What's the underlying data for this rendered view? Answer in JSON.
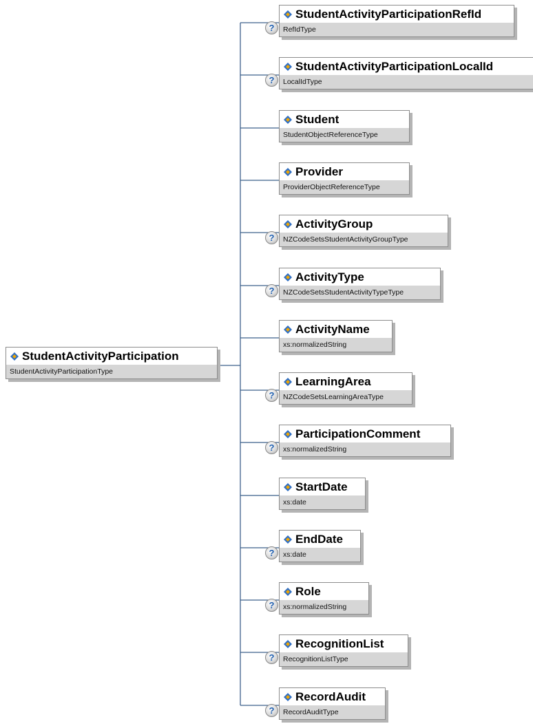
{
  "root": {
    "name": "StudentActivityParticipation",
    "type": "StudentActivityParticipationType"
  },
  "optional_marker": "?",
  "icon": "element-diamond-icon",
  "colors": {
    "connector": "#3b5f8a",
    "type_band": "#d6d6d6",
    "icon_blue": "#2f6fc4",
    "icon_orange": "#f2a600"
  },
  "children": [
    {
      "name": "StudentActivityParticipationRefId",
      "type": "RefIdType",
      "optional": true
    },
    {
      "name": "StudentActivityParticipationLocalId",
      "type": "LocalIdType",
      "optional": true
    },
    {
      "name": "Student",
      "type": "StudentObjectReferenceType",
      "optional": false
    },
    {
      "name": "Provider",
      "type": "ProviderObjectReferenceType",
      "optional": false
    },
    {
      "name": "ActivityGroup",
      "type": "NZCodeSetsStudentActivityGroupType",
      "optional": true
    },
    {
      "name": "ActivityType",
      "type": "NZCodeSetsStudentActivityTypeType",
      "optional": true
    },
    {
      "name": "ActivityName",
      "type": "xs:normalizedString",
      "optional": false
    },
    {
      "name": "LearningArea",
      "type": "NZCodeSetsLearningAreaType",
      "optional": true
    },
    {
      "name": "ParticipationComment",
      "type": "xs:normalizedString",
      "optional": true
    },
    {
      "name": "StartDate",
      "type": "xs:date",
      "optional": false
    },
    {
      "name": "EndDate",
      "type": "xs:date",
      "optional": true
    },
    {
      "name": "Role",
      "type": "xs:normalizedString",
      "optional": true
    },
    {
      "name": "RecognitionList",
      "type": "RecognitionListType",
      "optional": true
    },
    {
      "name": "RecordAudit",
      "type": "RecordAuditType",
      "optional": true
    }
  ]
}
